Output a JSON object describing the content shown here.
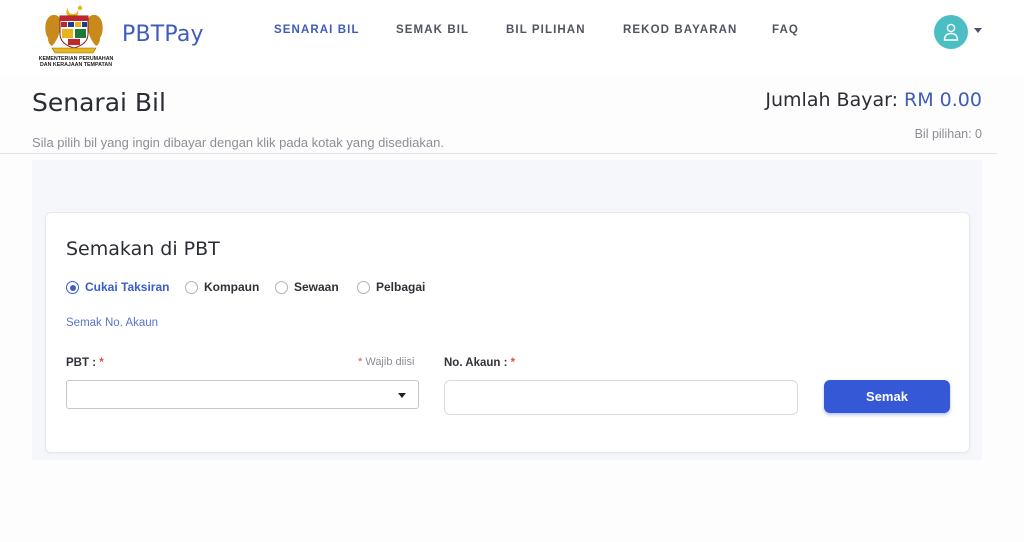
{
  "header": {
    "logo_text": "KEMENTERIAN PERUMAHAN DAN KERAJAAN TEMPATAN",
    "brand": "PBTPay",
    "nav": [
      {
        "label": "SENARAI BIL",
        "active": true
      },
      {
        "label": "SEMAK BIL",
        "active": false
      },
      {
        "label": "BIL PILIHAN",
        "active": false
      },
      {
        "label": "REKOD BAYARAN",
        "active": false
      },
      {
        "label": "FAQ",
        "active": false
      }
    ],
    "avatar_icon": "user-icon",
    "accent_color": "#3e5cb8",
    "avatar_color": "#4bbec3"
  },
  "page": {
    "title": "Senarai Bil",
    "subtitle": "Sila pilih bil yang ingin dibayar dengan klik pada kotak yang disediakan.",
    "total_label": "Jumlah Bayar:",
    "total_amount": "RM 0.00",
    "selected_count": "Bil pilihan: 0"
  },
  "form": {
    "title": "Semakan di PBT",
    "radios": [
      {
        "label": "Cukai Taksiran",
        "checked": true
      },
      {
        "label": "Kompaun",
        "checked": false
      },
      {
        "label": "Sewaan",
        "checked": false
      },
      {
        "label": "Pelbagai",
        "checked": false
      }
    ],
    "check_link": "Semak No. Akaun",
    "pbt_label": "PBT :",
    "required_marker": "*",
    "required_note": "Wajib diisi",
    "pbt_value": "",
    "account_label": "No. Akaun :",
    "account_value": "",
    "submit_label": "Semak",
    "button_color": "#3559d6"
  }
}
